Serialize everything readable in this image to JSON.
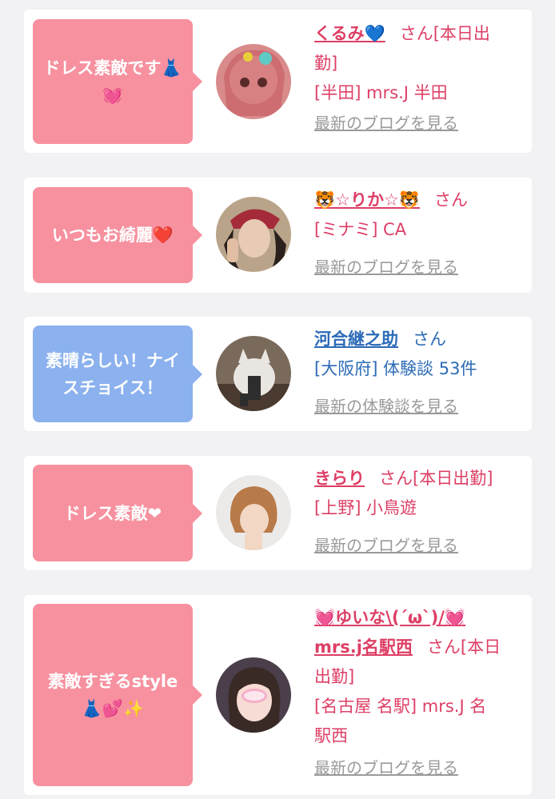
{
  "items": [
    {
      "comment": "ドレス素敵です👗💓",
      "name": "くるみ💙",
      "suffix": "さん[本日出",
      "suffix2": "勤]",
      "area": "[半田] mrs.J 半田",
      "link": "最新のブログを見る",
      "bubble_color": "#f7919f",
      "avatar": "avatar-kurumi"
    },
    {
      "comment": "いつもお綺麗❤️",
      "name": "🐯☆りか☆🐯",
      "suffix": "さん",
      "area": "[ミナミ] CA",
      "link": "最新のブログを見る",
      "bubble_color": "#f7919f",
      "avatar": "avatar-rika"
    },
    {
      "comment": "素晴らしい！ナイスチョイス！",
      "name": "河合継之助",
      "suffix": "さん",
      "area": "[大阪府] 体験談 53件",
      "link": "最新の体験談を見る",
      "bubble_color": "#8bb1ee",
      "avatar": "avatar-kawai"
    },
    {
      "comment": "ドレス素敵❤",
      "name": "きらり",
      "suffix": "さん[本日出勤]",
      "area": "[上野] 小鳥遊",
      "link": "最新のブログを見る",
      "bubble_color": "#f7919f",
      "avatar": "avatar-kirari"
    },
    {
      "comment": "素敵すぎるstyle👗💕✨",
      "name_line1": "💓ゆいな\\(´ω`)/💓",
      "name_line2": "mrs.j名駅西",
      "suffix": "さん[本日",
      "suffix2": "出勤]",
      "area": "[名古屋 名駅] mrs.J 名",
      "area2": "駅西",
      "link": "最新のブログを見る",
      "bubble_color": "#f7919f",
      "avatar": "avatar-yuina"
    }
  ]
}
